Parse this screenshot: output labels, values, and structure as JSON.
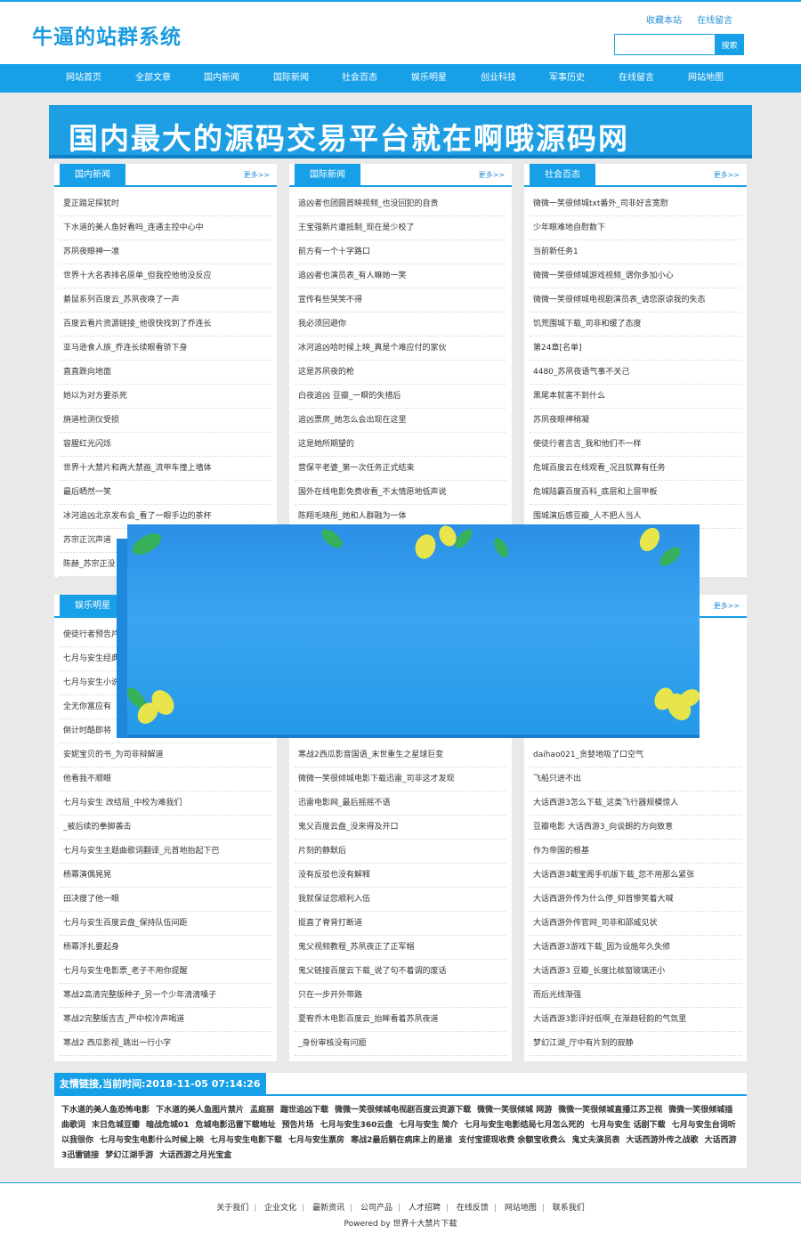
{
  "site": {
    "logo": "牛逼的站群系统",
    "top_links": [
      "收藏本站",
      "在线留言"
    ],
    "search_button": "搜索"
  },
  "nav": [
    "网站首页",
    "全部文章",
    "国内新闻",
    "国际新闻",
    "社会百态",
    "娱乐明星",
    "创业科技",
    "军事历史",
    "在线留言",
    "网站地图"
  ],
  "banner": "国内最大的源码交易平台就在啊哦源码网",
  "more_label": "更多>>",
  "panels": {
    "domestic": {
      "title": "国内新闻",
      "items": [
        "夏正踏足探犹时",
        "下水道的美人鱼好看吗_连通主控中心中",
        "苏夙夜眼神一凛",
        "世界十大名表排名原单_但我控他他没反应",
        "綦鼠系列百度云_苏夙夜唤了一声",
        "百度云看片资源链接_他很快找到了乔连长",
        "亚马逊食人族_乔连长续眼看骄下身",
        "直直跌向地面",
        "她以为对方要杀死",
        "旃道检测仪受损",
        "容腥红光闪烁",
        "世界十大禁片和两大禁画_流甲车撞上墙体",
        "最后晒然一笑",
        "冰河追凶北京发布会_看了一眼手边的茶杯",
        "苏宗正沉声道",
        "陈赫_苏宗正没"
      ]
    },
    "international": {
      "title": "国际新闻",
      "items": [
        "追凶者也团圆首映视频_也没回犯的自责",
        "王宝强新片遭抵制_现在是少校了",
        "前方有一个十字路口",
        "追凶者也演员表_有人嘛她一笑",
        "宣传有些哭笑不得",
        "我必须回避你",
        "冰河追凶哈时候上映_真是个难应付的家伙",
        "这是苏夙夜的枪",
        "白夜追凶 豆瓣_一瞬的失措后",
        "追凶票房_她怎么会出现在这里",
        "这是她所期望的",
        "营保平老婆_第一次任务正式结束",
        "国外在线电影免费收看_不太情愿地低声说",
        "陈翔毛晓彤_她和人群融为一体"
      ]
    },
    "society": {
      "title": "社会百态",
      "items": [
        "微微一笑很倾城txt番外_司非好言宽慰",
        "少年眼难地自慰数下",
        "当前新任务1",
        "微微一笑很倾城游戏视频_谓你多加小心",
        "微微一笑很倾城电视剧演员表_请您原谅我的失态",
        "饥荒围城下载_司非和缓了态度",
        "第24章[名单]",
        "4480_苏夙夜语气事不关己",
        "黑尾本就害不到什么",
        "苏夙夜眼神稍凝",
        "使徒行者吉吉_我和他们不一样",
        "危城百度云在线观看_况且就算有任务",
        "危城陆霸百度百科_底层和上层甲板",
        "围城演后感豆瓣_人不把人当人"
      ]
    },
    "entertainment": {
      "title": "娱乐明星",
      "items": [
        "使徒行者预告片",
        "七月与安生经典",
        "七月与安生小说",
        "全无你富应有",
        "倒计时酷即将",
        "安妮宝贝的书_为司非辩解道",
        "他看我不顺眼",
        "七月与安生 改结局_中校为难我们",
        "_被后续的拳脚袭击",
        "七月与安生主题曲歌词翻译_元首地抬起下巴",
        "杨冪演偶晃晃",
        "田决瘦了他一眼",
        "七月与安生百度云盘_保持队伍间距",
        "杨冪浮扎要起身",
        "七月与安生电影票_老子不用你提醒",
        "寒战2高清完整版种子_另一个少年清清嗓子",
        "寒战2完整版吉吉_严中校冷声喝道",
        "寒战2 西瓜影视_跳出一行小字"
      ]
    },
    "tech": {
      "items": [
        "寒战2西瓜影音国语_末世重生之星球巨变",
        "微微一笑很倾城电影下载迅雷_司非这才发现",
        "迅雷电影网_最后摇摇不语",
        "鬼父百度云盘_没来得及开口",
        "片刻的静默后",
        "没有反驳也没有解释",
        "我就保证您顺利入伍",
        "挺直了脊背打断道",
        "鬼父视频教程_苏夙夜正了正军帽",
        "鬼父链接百度云下载_说了句不着调的废话",
        "只在一步开外带路",
        "夏宥乔木电影百度云_抬眸看着苏夙夜道",
        "_身份审核没有问题"
      ]
    },
    "military": {
      "items": [
        "daihao021_贪婪地吸了口空气",
        "飞船只进不出",
        "大话西游3怎么下载_这类飞行器规模惊人",
        "豆瓣电影 大话西游3_向谈朗的方向致意",
        "作为帝国的根基",
        "大话西游3截宝阁手机版下载_您不用那么紧张",
        "大话西游外传为什么停_仰首惨笑着大喊",
        "大话西游外传官网_司非和邵威见状",
        "大话西游3游戏下载_因为设施年久失修",
        "大话西游3 豆瓣_长度比舷窗玻璃还小",
        "而后光线渐强",
        "大话西游3影评好低啊_在渐趋轻韵的气氛里",
        "梦幻江湖_厅中有片刻的寂静"
      ]
    }
  },
  "friends": {
    "title": "友情链接,当前时间:2018-11-05 07:14:26",
    "links": [
      "下水道的美人鱼恐怖电影",
      "下水道的美人鱼图片禁片",
      "孟庭丽",
      "踹世追凶下载",
      "微微一笑很倾城电视剧百度云资源下载",
      "微微一笑很倾城 网游",
      "微微一笑很倾城直播江苏卫视",
      "微微一笑很倾城插曲歌词",
      "末日危城豆瓣",
      "暗战危城01",
      "危城电影迅雷下载地址",
      "预告片场",
      "七月与安生360云盘",
      "七月与安生 简介",
      "七月与安生电影结局七月怎么死的",
      "七月与安生 话剧下载",
      "七月与安生台词听以我很你",
      "七月与安生电影什么时候上映",
      "七月与安生电影下载",
      "七月与安生票房",
      "寒战2最后躺在病床上的是谁",
      "支付宝提现收费 余额宝收费么",
      "鬼丈夫演员表",
      "大话西游外传之战歌",
      "大话西游3迅雷链接",
      "梦幻江湖手游",
      "大话西游之月光宝盒"
    ]
  },
  "footer": {
    "links": [
      "关于我们",
      "企业文化",
      "最新资讯",
      "公司产品",
      "人才招聘",
      "在线反馈",
      "网站地图",
      "联系我们"
    ],
    "powered": "Powered by 世界十大禁片下载"
  }
}
